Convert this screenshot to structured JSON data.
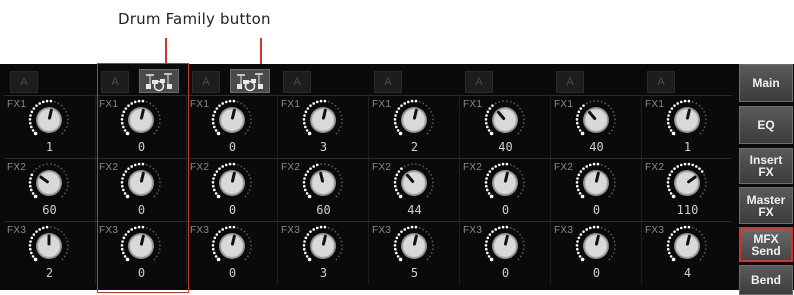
{
  "callout": {
    "text": "Drum Family button"
  },
  "header": {
    "a_label": "A"
  },
  "fx_labels": [
    "FX1",
    "FX2",
    "FX3"
  ],
  "columns": [
    {
      "drum": false,
      "knobs": [
        {
          "value": "1",
          "pct": 0.55
        },
        {
          "value": "60",
          "pct": 0.3
        },
        {
          "value": "2",
          "pct": 0.5
        }
      ]
    },
    {
      "drum": true,
      "knobs": [
        {
          "value": "0",
          "pct": 0.55
        },
        {
          "value": "0",
          "pct": 0.55
        },
        {
          "value": "0",
          "pct": 0.55
        }
      ]
    },
    {
      "drum": true,
      "knobs": [
        {
          "value": "0",
          "pct": 0.55
        },
        {
          "value": "0",
          "pct": 0.55
        },
        {
          "value": "0",
          "pct": 0.55
        }
      ]
    },
    {
      "drum": false,
      "knobs": [
        {
          "value": "3",
          "pct": 0.55
        },
        {
          "value": "60",
          "pct": 0.45
        },
        {
          "value": "3",
          "pct": 0.55
        }
      ]
    },
    {
      "drum": false,
      "knobs": [
        {
          "value": "2",
          "pct": 0.55
        },
        {
          "value": "44",
          "pct": 0.35
        },
        {
          "value": "5",
          "pct": 0.55
        }
      ]
    },
    {
      "drum": false,
      "knobs": [
        {
          "value": "40",
          "pct": 0.35
        },
        {
          "value": "0",
          "pct": 0.55
        },
        {
          "value": "0",
          "pct": 0.55
        }
      ]
    },
    {
      "drum": false,
      "knobs": [
        {
          "value": "40",
          "pct": 0.35
        },
        {
          "value": "0",
          "pct": 0.55
        },
        {
          "value": "0",
          "pct": 0.55
        }
      ]
    },
    {
      "drum": false,
      "knobs": [
        {
          "value": "1",
          "pct": 0.55
        },
        {
          "value": "110",
          "pct": 0.7
        },
        {
          "value": "4",
          "pct": 0.55
        }
      ]
    }
  ],
  "sidebar": {
    "items": [
      {
        "label": "Main",
        "active": false
      },
      {
        "label": "EQ",
        "active": false
      },
      {
        "label": "Insert\nFX",
        "active": false
      },
      {
        "label": "Master\nFX",
        "active": false
      },
      {
        "label": "MFX\nSend",
        "active": true
      },
      {
        "label": "Bend",
        "active": false
      }
    ]
  }
}
